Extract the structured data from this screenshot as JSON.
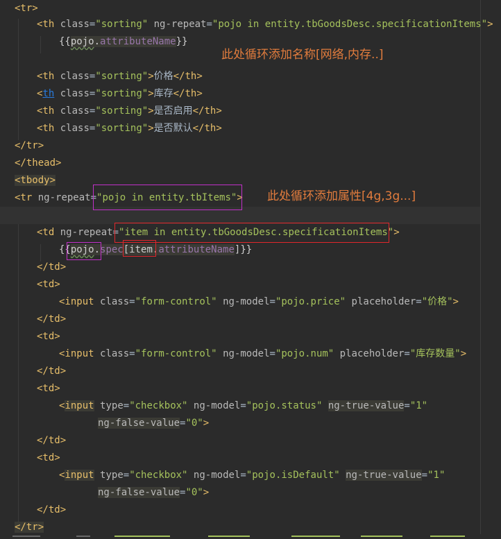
{
  "code": {
    "tr_open": "<tr>",
    "th1": {
      "open": "<th",
      "class_attr": "class",
      "class_val": "\"sorting\"",
      "repeat_attr": "ng-repeat",
      "repeat_val": "\"pojo in entity.tbGoodsDesc.specificationItems\"",
      "close": ">"
    },
    "th1_expr": {
      "open": "{{",
      "obj": "pojo",
      "dot": ".",
      "field": "attributeName",
      "close": "}}"
    },
    "th_price": {
      "open": "<th",
      "class_attr": "class",
      "class_val": "\"sorting\"",
      "text": "价格",
      "end": "</th>"
    },
    "th_stock": {
      "tag": "th",
      "class_attr": "class",
      "class_val": "\"sorting\"",
      "text": "库存",
      "end": "</th>"
    },
    "th_enabled": {
      "open": "<th",
      "class_attr": "class",
      "class_val": "\"sorting\"",
      "text": "是否启用",
      "end": "</th>"
    },
    "th_default": {
      "open": "<th",
      "class_attr": "class",
      "class_val": "\"sorting\"",
      "text": "是否默认",
      "end": "</th>"
    },
    "tr_close": "</tr>",
    "thead_close": "</thead>",
    "tbody_open": "<tbody>",
    "tr_items": {
      "open": "<tr",
      "attr": "ng-repeat",
      "val": "\"pojo in entity.tbItems\"",
      "close": ">"
    },
    "td_spec": {
      "open": "<td",
      "attr": "ng-repeat",
      "val": "\"item in entity.tbGoodsDesc.specificationItems\"",
      "close": ">"
    },
    "td_spec_expr": {
      "open": "{{",
      "obj": "pojo",
      "dot1": ".",
      "spec": "spec",
      "bracket_open": "[",
      "item": "item",
      "dot2": ".",
      "field": "attributeName",
      "close": "]}}"
    },
    "td_close": "</td>",
    "td_open": "<td>",
    "input_price": {
      "open": "<input",
      "class_attr": "class",
      "class_val": "\"form-control\"",
      "model_attr": "ng-model",
      "model_val": "\"pojo.price\"",
      "ph_attr": "placeholder",
      "ph_val": "\"价格\"",
      "close": ">"
    },
    "input_num": {
      "open": "<input",
      "class_attr": "class",
      "class_val": "\"form-control\"",
      "model_attr": "ng-model",
      "model_val": "\"pojo.num\"",
      "ph_attr": "placeholder",
      "ph_val": "\"库存数量\"",
      "close": ">"
    },
    "input_status": {
      "lt": "<",
      "tag": "input",
      "type_attr": "type",
      "type_val": "\"checkbox\"",
      "model_attr": "ng-model",
      "model_val": "\"pojo.status\"",
      "true_attr": "ng-true-value",
      "true_val": "\"1\""
    },
    "input_status_cont": {
      "false_attr": "ng-false-value",
      "false_val": "\"0\"",
      "close": ">"
    },
    "input_default": {
      "lt": "<",
      "tag": "input",
      "type_attr": "type",
      "type_val": "\"checkbox\"",
      "model_attr": "ng-model",
      "model_val": "\"pojo.isDefault\"",
      "true_attr": "ng-true-value",
      "true_val": "\"1\""
    },
    "input_default_cont": {
      "false_attr": "ng-false-value",
      "false_val": "\"0\"",
      "close": ">"
    },
    "tr_end": "</tr>"
  },
  "annotations": {
    "header_loop": "此处循环添加名称[网络,内存..]",
    "row_loop": "此处循环添加属性[4g,3g...]"
  },
  "colors": {
    "background": "#2b2b2b",
    "tag": "#e8bf6a",
    "attribute": "#bababa",
    "string": "#a5c25c",
    "field": "#9876aa",
    "annotation": "#e27c3d",
    "box_magenta": "#c230c9",
    "box_red": "#e2262b"
  }
}
